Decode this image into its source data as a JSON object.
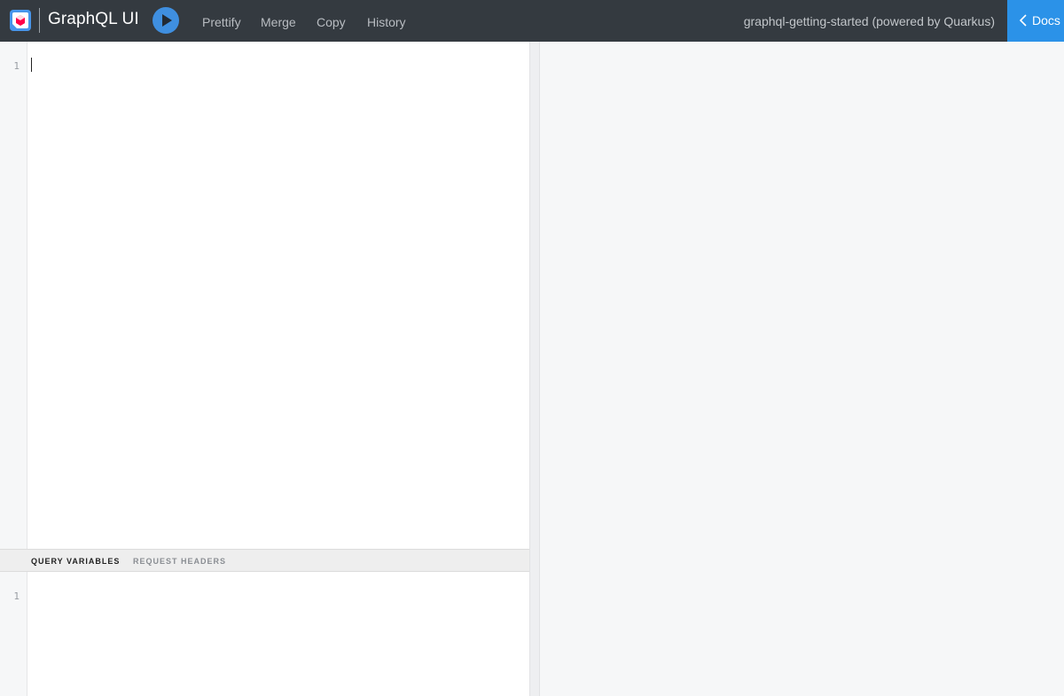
{
  "header": {
    "title": "GraphQL UI",
    "toolbar": [
      "Prettify",
      "Merge",
      "Copy",
      "History"
    ],
    "server_label": "graphql-getting-started (powered by Quarkus)",
    "docs_label": "Docs"
  },
  "editor": {
    "line_numbers": [
      "1"
    ]
  },
  "variables": {
    "tabs": [
      "QUERY VARIABLES",
      "REQUEST HEADERS"
    ],
    "line_numbers": [
      "1"
    ]
  },
  "colors": {
    "topbar": "#343a40",
    "accent": "#2b92e8",
    "run_button": "#3f8fe0"
  },
  "icons": {
    "logo": "quarkus-logo-icon",
    "run": "play-icon",
    "docs": "chevron-left-icon"
  }
}
